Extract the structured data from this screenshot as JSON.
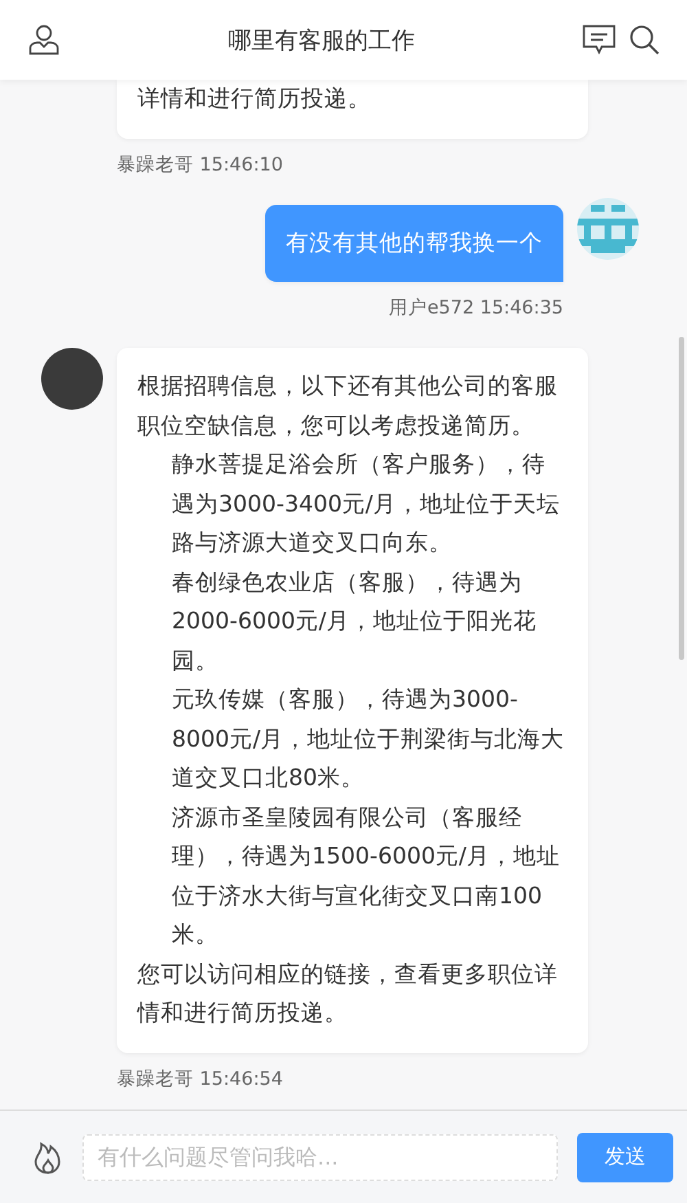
{
  "header": {
    "title": "哪里有客服的工作"
  },
  "messages": [
    {
      "kind": "bot",
      "paragraphs": [
        {
          "kind": "text",
          "text": "详情和进行简历投递。"
        }
      ],
      "meta": "暴躁老哥 15:46:10",
      "avatar": false
    },
    {
      "kind": "user",
      "paragraphs": [
        {
          "kind": "text",
          "text": "有没有其他的帮我换一个"
        }
      ],
      "meta": "用户e572 15:46:35",
      "avatar": true
    },
    {
      "kind": "bot",
      "paragraphs": [
        {
          "kind": "text",
          "text": "根据招聘信息，以下还有其他公司的客服职位空缺信息，您可以考虑投递简历。"
        },
        {
          "kind": "item",
          "text": "静水菩提足浴会所（客户服务），待遇为3000-3400元/月，地址位于天坛路与济源大道交叉口向东。"
        },
        {
          "kind": "item",
          "text": "春创绿色农业店（客服），待遇为2000-6000元/月，地址位于阳光花园。"
        },
        {
          "kind": "item",
          "text": "元玖传媒（客服），待遇为3000-8000元/月，地址位于荆梁街与北海大道交叉口北80米。"
        },
        {
          "kind": "item",
          "text": "济源市圣皇陵园有限公司（客服经理），待遇为1500-6000元/月，地址位于济水大街与宣化街交叉口南100米。"
        },
        {
          "kind": "text",
          "text": "您可以访问相应的链接，查看更多职位详情和进行简历投递。"
        }
      ],
      "meta": "暴躁老哥 15:46:54",
      "avatar": true
    }
  ],
  "composer": {
    "placeholder": "有什么问题尽管问我哈...",
    "send": "发送"
  }
}
